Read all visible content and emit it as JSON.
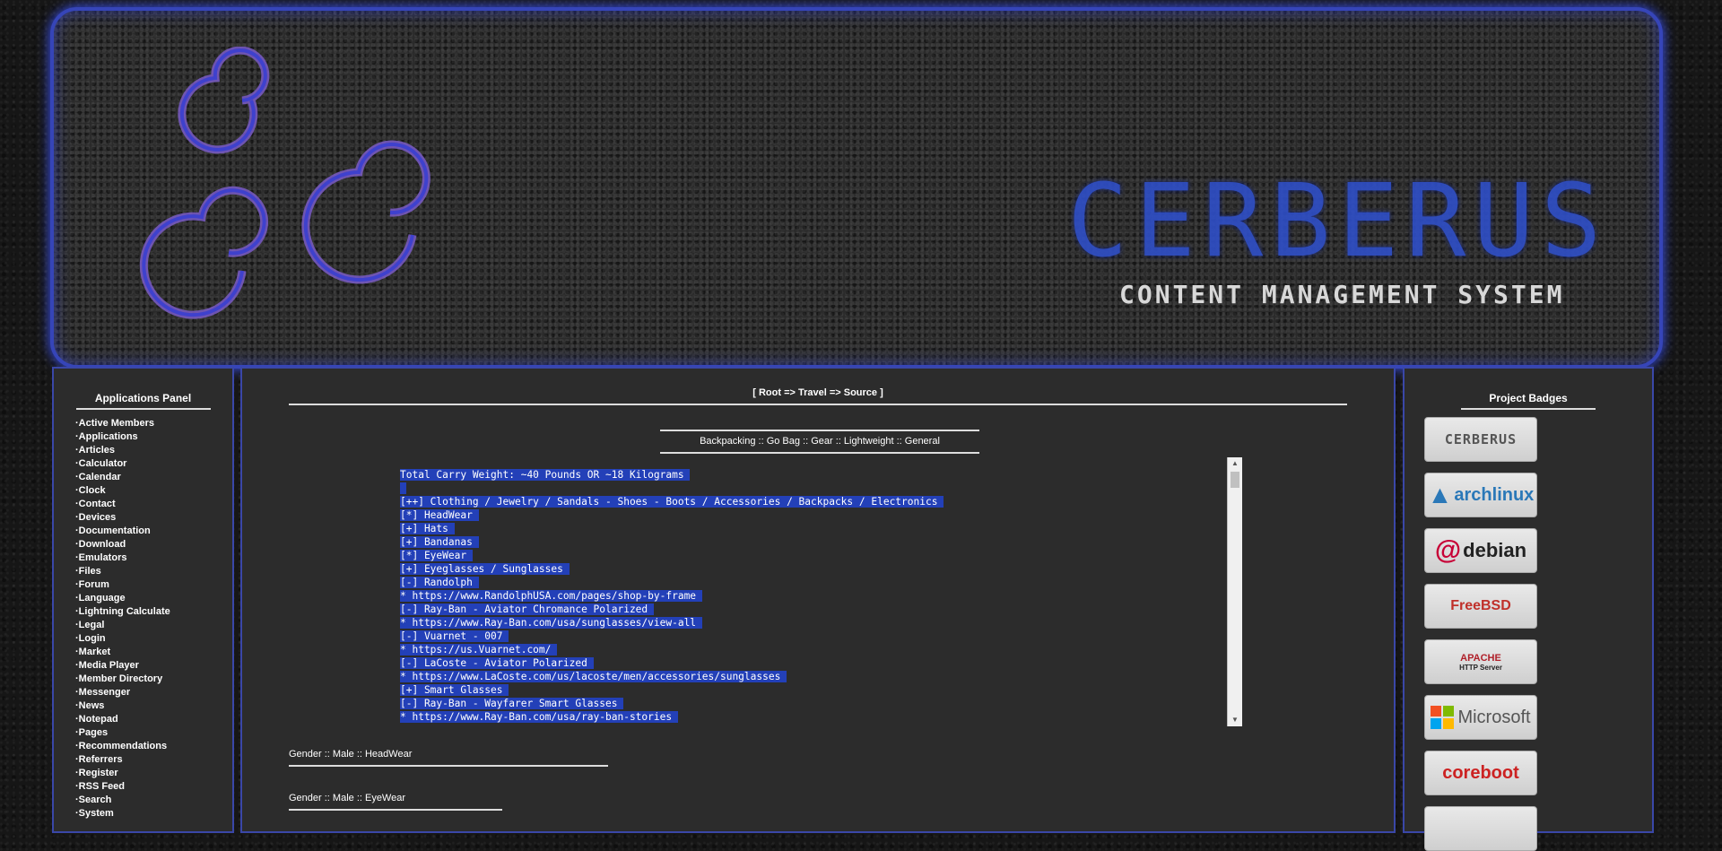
{
  "banner": {
    "title": "CERBERUS",
    "subtitle": "CONTENT MANAGEMENT SYSTEM"
  },
  "left_panel": {
    "title": "Applications Panel",
    "items": [
      "Active Members",
      "Applications",
      "Articles",
      "Calculator",
      "Calendar",
      "Clock",
      "Contact",
      "Devices",
      "Documentation",
      "Download",
      "Emulators",
      "Files",
      "Forum",
      "Language",
      "Lightning Calculate",
      "Legal",
      "Login",
      "Market",
      "Media Player",
      "Member Directory",
      "Messenger",
      "News",
      "Notepad",
      "Pages",
      "Recommendations",
      "Referrers",
      "Register",
      "RSS Feed",
      "Search",
      "System"
    ]
  },
  "main": {
    "breadcrumb": "[ Root => Travel => Source ]",
    "subnav": "Backpacking :: Go Bag :: Gear :: Lightweight :: General",
    "code_lines": [
      "Total Carry Weight: ~40 Pounds OR ~18 Kilograms ",
      " ",
      "[++] Clothing / Jewelry / Sandals - Shoes - Boots / Accessories / Backpacks / Electronics ",
      "[*] HeadWear ",
      "[+] Hats ",
      "[+] Bandanas ",
      "[*] EyeWear ",
      "[+] Eyeglasses / Sunglasses ",
      "[-] Randolph ",
      "* https://www.RandolphUSA.com/pages/shop-by-frame ",
      "[-] Ray-Ban - Aviator Chromance Polarized ",
      "* https://www.Ray-Ban.com/usa/sunglasses/view-all ",
      "[-] Vuarnet - 007 ",
      "* https://us.Vuarnet.com/ ",
      "[-] LaCoste - Aviator Polarized ",
      "* https://www.LaCoste.com/us/lacoste/men/accessories/sunglasses ",
      "[+] Smart Glasses ",
      "[-] Ray-Ban - Wayfarer Smart Glasses ",
      "* https://www.Ray-Ban.com/usa/ray-ban-stories "
    ],
    "section_headwear": "Gender :: Male :: HeadWear",
    "section_eyewear": "Gender :: Male :: EyeWear"
  },
  "right_panel": {
    "title": "Project Badges",
    "badges": [
      "CERBERUS",
      "archlinux",
      "debian",
      "FreeBSD",
      "APACHE",
      "HTTP Server",
      "Microsoft",
      "coreboot"
    ]
  },
  "colors": {
    "accent": "#3a47a8",
    "selection": "#2340b8",
    "panel_bg": "#2c2c2c"
  }
}
